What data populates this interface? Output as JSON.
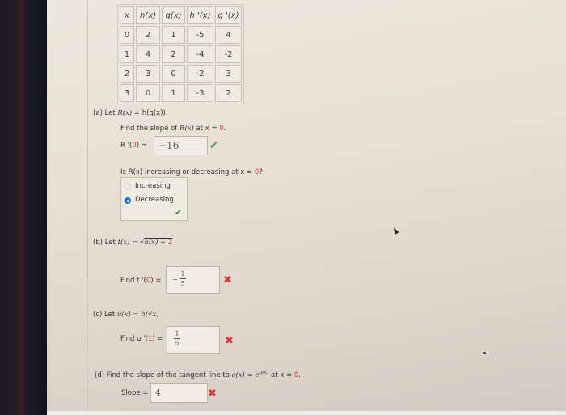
{
  "table": {
    "headers": [
      "x",
      "h(x)",
      "g(x)",
      "h '(x)",
      "g '(x)"
    ],
    "rows": [
      [
        "0",
        "2",
        "1",
        "-5",
        "4"
      ],
      [
        "1",
        "4",
        "2",
        "-4",
        "-2"
      ],
      [
        "2",
        "3",
        "0",
        "-2",
        "3"
      ],
      [
        "3",
        "0",
        "1",
        "-3",
        "2"
      ]
    ]
  },
  "part_a": {
    "label": "(a) Let",
    "def_lhs": "R(x)",
    "def_rhs": " = h(g(x)).",
    "prompt": "Find the slope of",
    "prompt_fn": "R(x)",
    "prompt_at": " at x = ",
    "prompt_x": "0",
    "prompt_end": ".",
    "answer_label_fn": "R '(",
    "answer_label_x": "0",
    "answer_label_end": ") =",
    "answer": "−16",
    "answer_status": "correct",
    "question2": "Is R(x) increasing or decreasing at x = ",
    "question2_x": "0",
    "question2_end": "?",
    "options": [
      {
        "label": "Increasing",
        "selected": false
      },
      {
        "label": "Decreasing",
        "selected": true
      }
    ],
    "options_status": "correct"
  },
  "part_b": {
    "label": "(b) Let",
    "def": "t(x) = √",
    "def_inner": "h(x) + ",
    "def_const": "2",
    "find_label": "Find t '(",
    "find_x": "0",
    "find_end": ") =",
    "answer_sign": "−",
    "answer_num": "1",
    "answer_den": "5",
    "answer_status": "incorrect"
  },
  "part_c": {
    "label": "(c) Let",
    "def": "u(x) = h(√x)",
    "find_label": "Find u '(",
    "find_x": "1",
    "find_end": ") =",
    "answer_num": "1",
    "answer_den": "5",
    "answer_status": "incorrect"
  },
  "part_d": {
    "label": "(d) Find the slope of the tangent line to",
    "fn": "c(x) = e",
    "fn_exp": "g(x)",
    "at": " at x = ",
    "x": "0",
    "end": ".",
    "slope_label": "Slope =",
    "answer": "4",
    "answer_status": "incorrect"
  },
  "icons": {
    "check": "✔",
    "cross": "✖"
  }
}
